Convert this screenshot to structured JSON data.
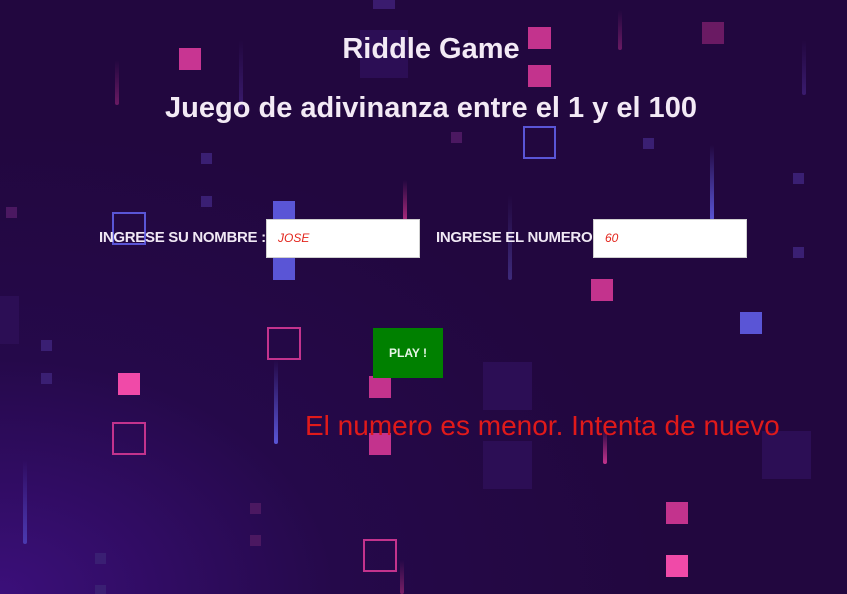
{
  "page": {
    "title": "Riddle Game",
    "subtitle": "Juego de adivinanza entre el 1 y el 100"
  },
  "form": {
    "name_label": "INGRESE SU NOMBRE :",
    "name_value": "JOSE",
    "number_label": "INGRESE EL NUMERO",
    "number_value": "60",
    "play_label": "PLAY !"
  },
  "result": {
    "message": "El numero es menor. Intenta de nuevo"
  },
  "colors": {
    "background": "#22073f",
    "play_button": "#008000",
    "message": "#e01a1a",
    "input_text": "#e3261d",
    "accent_pink": "#d9338f",
    "accent_blue": "#5a55d6"
  }
}
